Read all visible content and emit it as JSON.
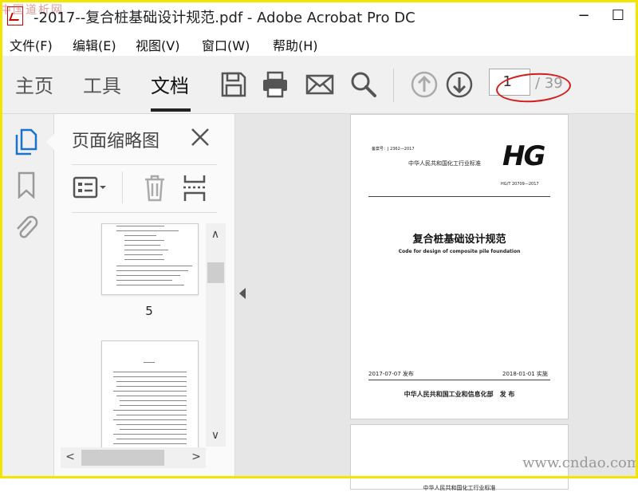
{
  "window": {
    "title": "-2017--复合桩基础设计规范.pdf - Adobe Acrobat Pro DC",
    "watermark_tl": "中国道析网",
    "minimize": "−",
    "maximize": "☐"
  },
  "menu": [
    "文件(F)",
    "编辑(E)",
    "视图(V)",
    "窗口(W)",
    "帮助(H)"
  ],
  "tabs": [
    "主页",
    "工具",
    "文档"
  ],
  "active_tab": "文档",
  "toolbar": {
    "icons": [
      "save-icon",
      "print-icon",
      "email-icon",
      "search-icon",
      "page-up-icon",
      "page-down-icon"
    ],
    "page_current": "1",
    "page_total": "/ 39"
  },
  "thumbnails": {
    "title": "页面缩略图",
    "page_labels": [
      "5"
    ]
  },
  "document": {
    "header_code": "备案号：J 2362—2017",
    "issuer_top": "中华人民共和国化工行业标准",
    "logo": "HG",
    "std_number": "HG/T 20709—2017",
    "title_cn": "复合桩基础设计规范",
    "title_en": "Code for design of composite pile foundation",
    "issue_date": "2017-07-07 发布",
    "impl_date": "2018-01-01 实施",
    "publisher": "中华人民共和国工业和信息化部　发 布",
    "page2_partial": "中华人民共和国化工行业标准"
  },
  "watermark_bottom": "www.cndao.com",
  "colors": {
    "accent_red": "#d41c1c",
    "frame_yellow": "#f2e600"
  }
}
